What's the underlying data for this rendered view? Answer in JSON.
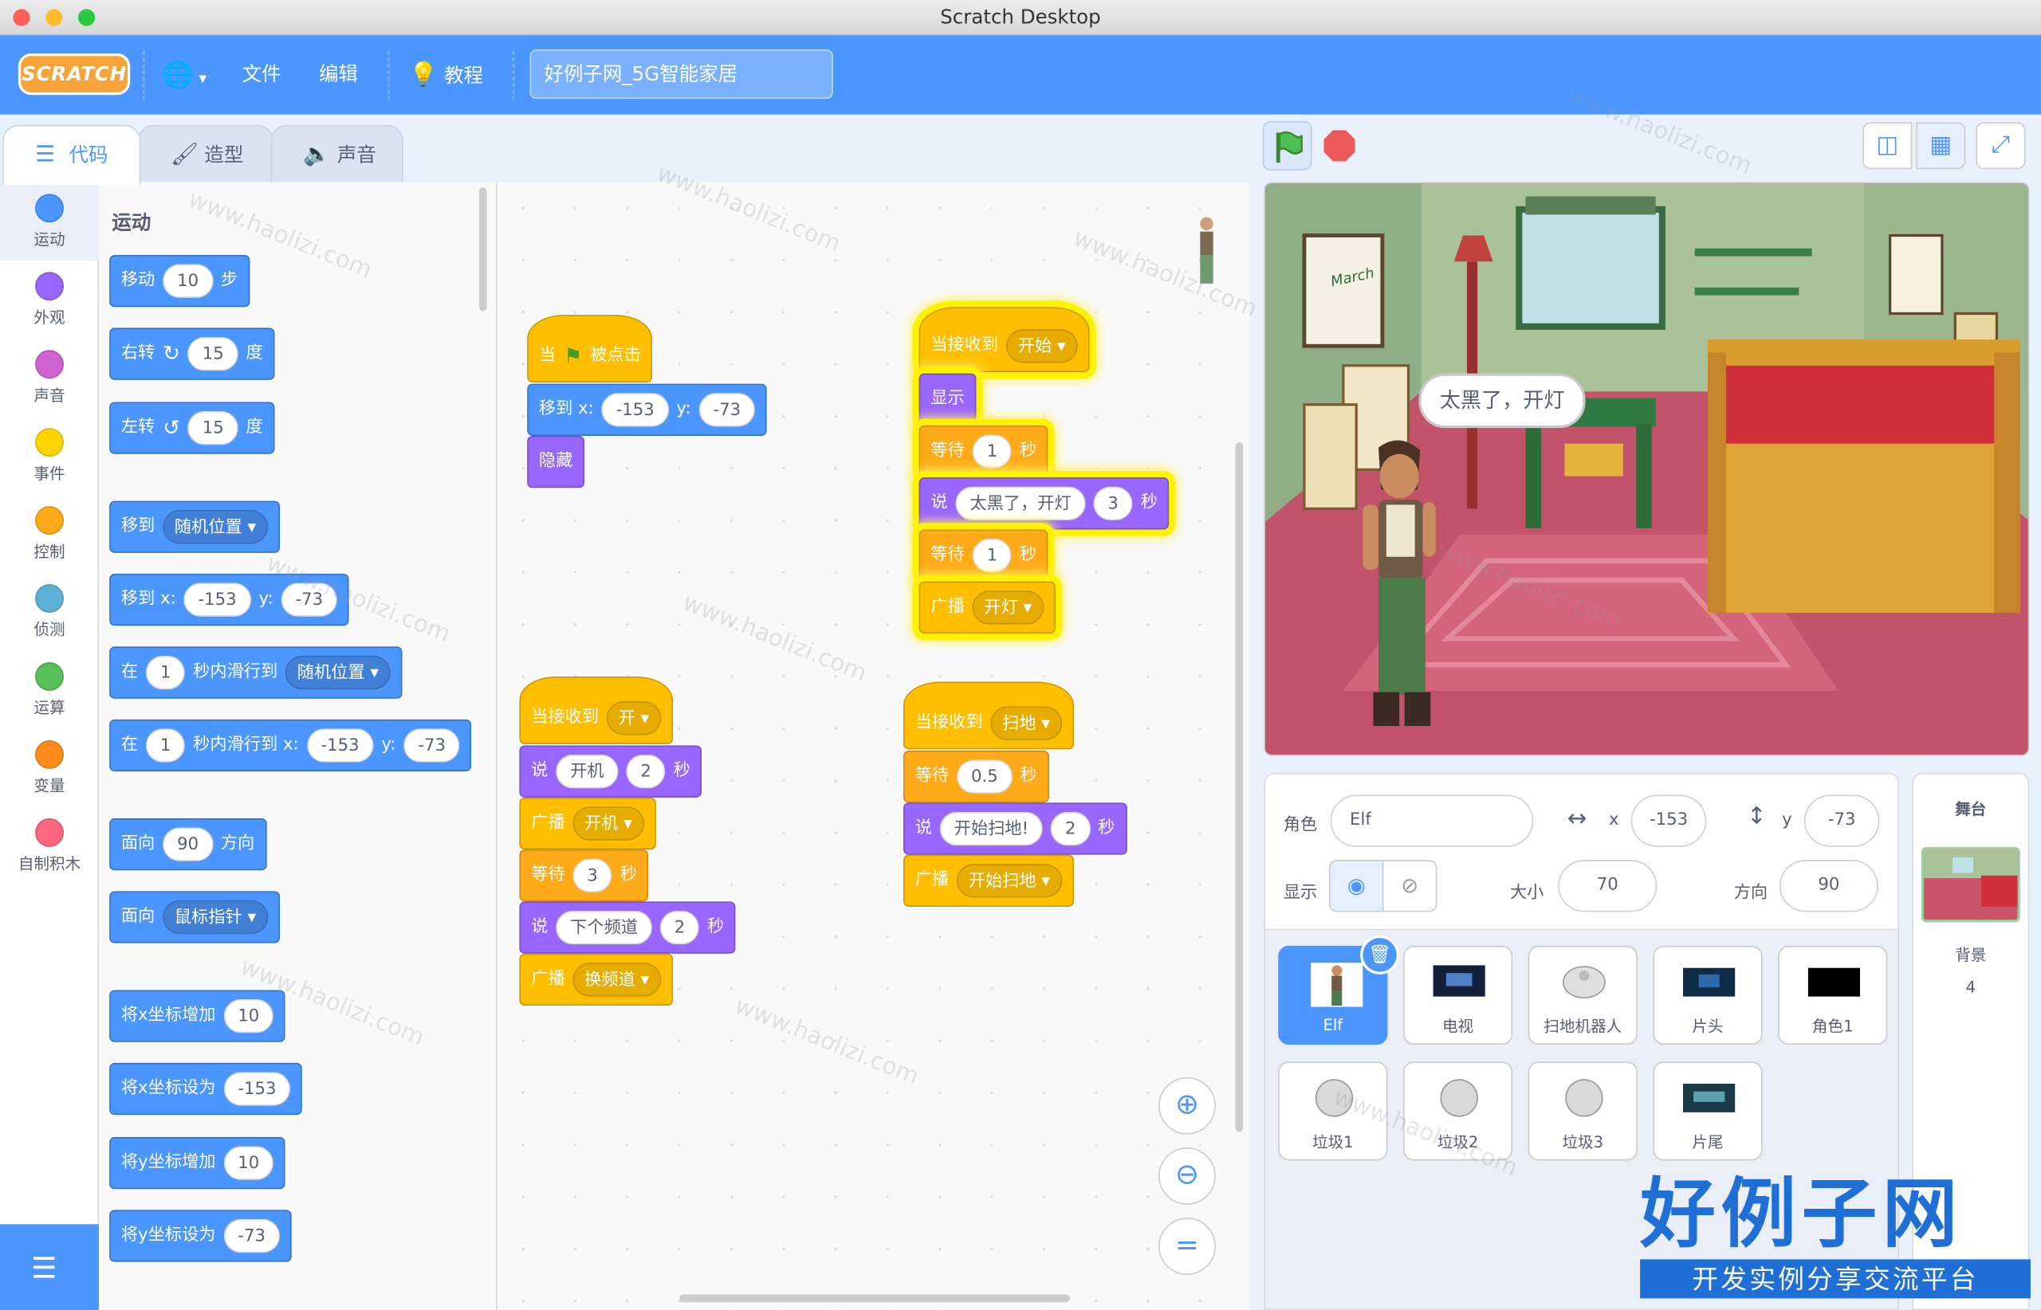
{
  "window": {
    "title": "Scratch Desktop"
  },
  "menu": {
    "logo": "SCRATCH",
    "file": "文件",
    "edit": "编辑",
    "tutorials": "教程",
    "project_title": "好例子网_5G智能家居"
  },
  "tabs": {
    "code": "代码",
    "costumes": "造型",
    "sounds": "声音"
  },
  "categories": [
    {
      "label": "运动",
      "color": "#4c97ff"
    },
    {
      "label": "外观",
      "color": "#9966ff"
    },
    {
      "label": "声音",
      "color": "#cf63cf"
    },
    {
      "label": "事件",
      "color": "#ffd500"
    },
    {
      "label": "控制",
      "color": "#ffab19"
    },
    {
      "label": "侦测",
      "color": "#5cb1d6"
    },
    {
      "label": "运算",
      "color": "#59c059"
    },
    {
      "label": "变量",
      "color": "#ff8c1a"
    },
    {
      "label": "自制积木",
      "color": "#ff6680"
    }
  ],
  "palette": {
    "heading": "运动",
    "move": {
      "a": "移动",
      "n": "10",
      "b": "步"
    },
    "turn_right": {
      "a": "右转",
      "n": "15",
      "b": "度"
    },
    "turn_left": {
      "a": "左转",
      "n": "15",
      "b": "度"
    },
    "goto": {
      "a": "移到",
      "dd": "随机位置"
    },
    "goto_xy": {
      "a": "移到 x:",
      "x": "-153",
      "yl": "y:",
      "y": "-73"
    },
    "glide": {
      "a": "在",
      "n": "1",
      "b": "秒内滑行到",
      "dd": "随机位置"
    },
    "glide_xy": {
      "a": "在",
      "n": "1",
      "b": "秒内滑行到 x:",
      "x": "-153",
      "yl": "y:",
      "y": "-73"
    },
    "point_dir": {
      "a": "面向",
      "n": "90",
      "b": "方向"
    },
    "point_towards": {
      "a": "面向",
      "dd": "鼠标指针"
    },
    "change_x": {
      "a": "将x坐标增加",
      "n": "10"
    },
    "set_x": {
      "a": "将x坐标设为",
      "n": "-153"
    },
    "change_y": {
      "a": "将y坐标增加",
      "n": "10"
    },
    "set_y": {
      "a": "将y坐标设为",
      "n": "-73"
    }
  },
  "scripts": {
    "s1": {
      "hat": {
        "a": "当",
        "b": "被点击"
      },
      "goto": {
        "a": "移到 x:",
        "x": "-153",
        "yl": "y:",
        "y": "-73"
      },
      "hide": "隐藏"
    },
    "s2": {
      "hat": {
        "a": "当接收到",
        "dd": "开始"
      },
      "show": "显示",
      "wait1": {
        "a": "等待",
        "n": "1",
        "b": "秒"
      },
      "say": {
        "a": "说",
        "t": "太黑了，开灯",
        "n": "3",
        "b": "秒"
      },
      "wait2": {
        "a": "等待",
        "n": "1",
        "b": "秒"
      },
      "broadcast": {
        "a": "广播",
        "dd": "开灯"
      }
    },
    "s3": {
      "hat": {
        "a": "当接收到",
        "dd": "开"
      },
      "say1": {
        "a": "说",
        "t": "开机",
        "n": "2",
        "b": "秒"
      },
      "broadcast1": {
        "a": "广播",
        "dd": "开机"
      },
      "wait": {
        "a": "等待",
        "n": "3",
        "b": "秒"
      },
      "say2": {
        "a": "说",
        "t": "下个频道",
        "n": "2",
        "b": "秒"
      },
      "broadcast2": {
        "a": "广播",
        "dd": "换频道"
      }
    },
    "s4": {
      "hat": {
        "a": "当接收到",
        "dd": "扫地"
      },
      "wait": {
        "a": "等待",
        "n": "0.5",
        "b": "秒"
      },
      "say": {
        "a": "说",
        "t": "开始扫地!",
        "n": "2",
        "b": "秒"
      },
      "broadcast": {
        "a": "广播",
        "dd": "开始扫地"
      }
    }
  },
  "stage": {
    "speech": "太黑了，开灯",
    "calendar_text": "March"
  },
  "sprite_info": {
    "sprite_label": "角色",
    "sprite_name": "Elf",
    "x_label": "x",
    "x": "-153",
    "y_label": "y",
    "y": "-73",
    "show_label": "显示",
    "size_label": "大小",
    "size": "70",
    "direction_label": "方向",
    "direction": "90"
  },
  "sprites": [
    {
      "name": "Elf"
    },
    {
      "name": "电视"
    },
    {
      "name": "扫地机器人"
    },
    {
      "name": "片头"
    },
    {
      "name": "角色1"
    },
    {
      "name": "垃圾1"
    },
    {
      "name": "垃圾2"
    },
    {
      "name": "垃圾3"
    },
    {
      "name": "片尾"
    }
  ],
  "stage_pane": {
    "title": "舞台",
    "backdrops_label": "背景",
    "backdrops_count": "4"
  },
  "watermark": "www.haolizi.com",
  "brand": {
    "title": "好例子网",
    "subtitle": "开发实例分享交流平台"
  },
  "colors": {
    "accent": "#4c97ff",
    "motion": "#4c97ff",
    "looks": "#9966ff",
    "events": "#ffbf00"
  }
}
